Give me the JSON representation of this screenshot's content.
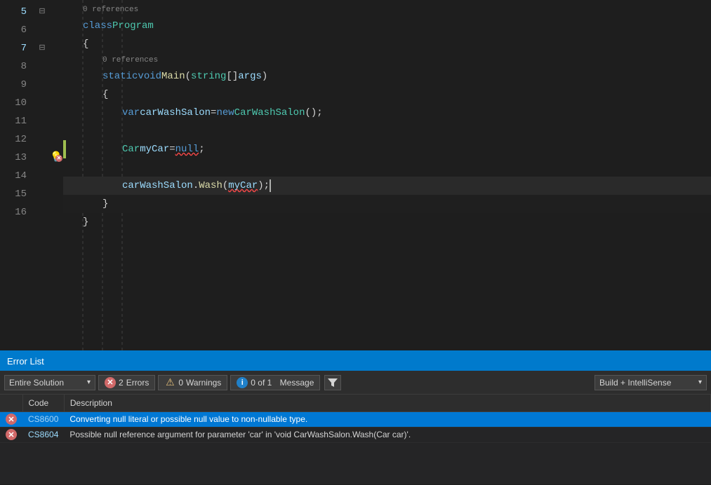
{
  "editor": {
    "lines": [
      {
        "num": "5",
        "indent": 1,
        "content_type": "class_decl",
        "refs": "0 references"
      },
      {
        "num": "6",
        "indent": 1,
        "content_type": "open_brace"
      },
      {
        "num": "7",
        "indent": 2,
        "content_type": "main_method",
        "refs": "0 references"
      },
      {
        "num": "8",
        "indent": 2,
        "content_type": "open_brace2"
      },
      {
        "num": "9",
        "indent": 3,
        "content_type": "var_decl"
      },
      {
        "num": "10",
        "indent": 3,
        "content_type": "empty"
      },
      {
        "num": "11",
        "indent": 3,
        "content_type": "car_decl",
        "has_yellow_bar": true
      },
      {
        "num": "12",
        "indent": 3,
        "content_type": "empty2"
      },
      {
        "num": "13",
        "indent": 3,
        "content_type": "wash_call",
        "has_warning": true
      },
      {
        "num": "14",
        "indent": 2,
        "content_type": "close_brace2"
      },
      {
        "num": "15",
        "indent": 1,
        "content_type": "close_brace3"
      },
      {
        "num": "16",
        "indent": 1,
        "content_type": "empty3"
      }
    ]
  },
  "errorList": {
    "title": "Error List",
    "filter": {
      "label": "Entire Solution",
      "chevron": "▾"
    },
    "buttons": {
      "errors": {
        "count": "2",
        "label": "Errors"
      },
      "warnings": {
        "count": "0",
        "label": "Warnings"
      },
      "messages": {
        "count": "0 of 1",
        "label": "Message"
      },
      "build": "Build + IntelliSense",
      "build_chevron": "▾"
    },
    "columns": [
      {
        "label": ""
      },
      {
        "label": "Code"
      },
      {
        "label": "Description"
      }
    ],
    "errors": [
      {
        "code": "CS8600",
        "description": "Converting null literal or possible null value to non-nullable type.",
        "selected": true
      },
      {
        "code": "CS8604",
        "description": "Possible null reference argument for parameter 'car' in 'void CarWashSalon.Wash(Car car)'.",
        "selected": false
      }
    ]
  },
  "colors": {
    "accent": "#007acc",
    "error": "#d16969",
    "warning": "#e5c07b",
    "info": "#2080c8"
  }
}
